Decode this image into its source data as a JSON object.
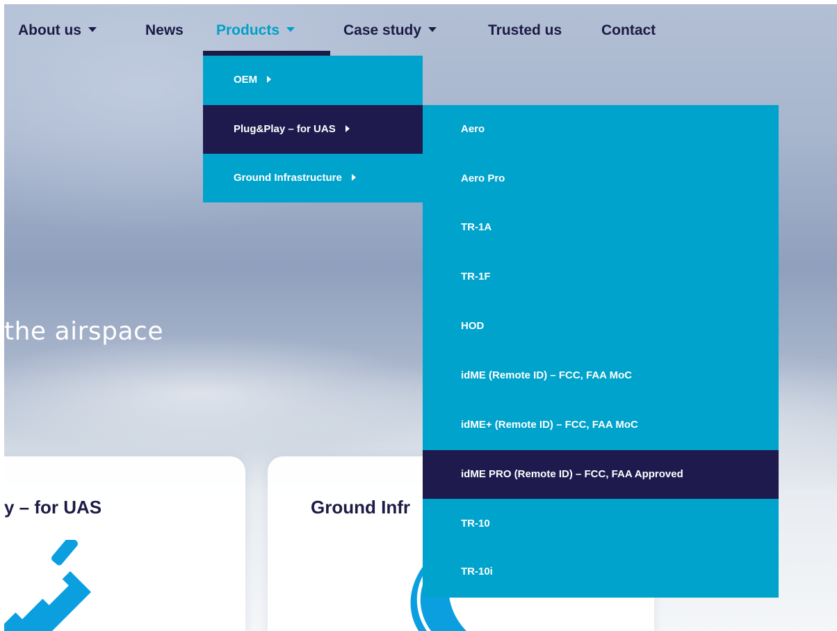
{
  "nav": {
    "items": [
      {
        "label": "About us",
        "has_caret": true
      },
      {
        "label": "News",
        "has_caret": false
      },
      {
        "label": "Products",
        "has_caret": true,
        "active": true
      },
      {
        "label": "Case study",
        "has_caret": true
      },
      {
        "label": "Trusted us",
        "has_caret": false
      },
      {
        "label": "Contact",
        "has_caret": false
      }
    ]
  },
  "products_menu": {
    "items": [
      {
        "label": "OEM"
      },
      {
        "label": "Plug&Play – for UAS",
        "highlighted": true
      },
      {
        "label": "Ground Infrastructure"
      }
    ]
  },
  "plugplay_submenu": {
    "items": [
      {
        "label": "Aero"
      },
      {
        "label": "Aero Pro"
      },
      {
        "label": "TR-1A"
      },
      {
        "label": "TR-1F"
      },
      {
        "label": "HOD"
      },
      {
        "label": "idME (Remote ID) – FCC, FAA MoC"
      },
      {
        "label": "idME+ (Remote ID) – FCC, FAA MoC"
      },
      {
        "label": "idME PRO (Remote ID) – FCC, FAA Approved",
        "highlighted": true
      },
      {
        "label": "TR-10"
      },
      {
        "label": "TR-10i"
      }
    ]
  },
  "hero": {
    "text": "the airspace"
  },
  "cards": [
    {
      "title": "y – for UAS",
      "icon": "plug-icon"
    },
    {
      "title": "Ground Infr",
      "icon": "antenna-icon"
    }
  ],
  "colors": {
    "navy": "#1d1b45",
    "accent": "#00a3cb",
    "highlight": "#1f1a4e"
  }
}
